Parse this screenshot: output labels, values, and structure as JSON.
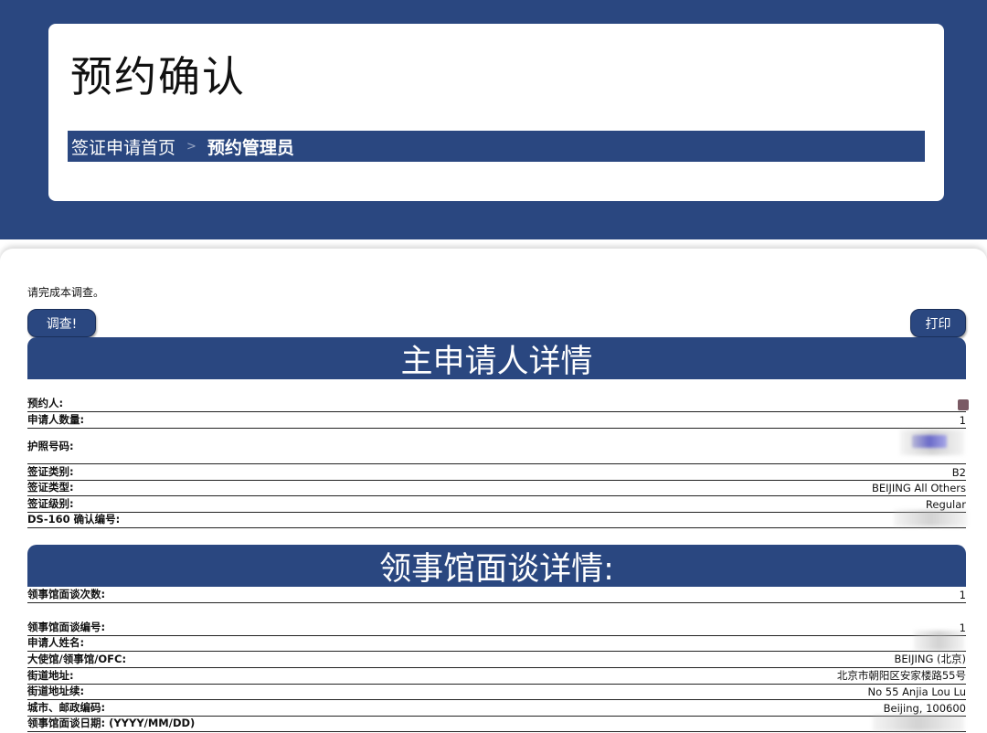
{
  "header": {
    "title": "预约确认",
    "breadcrumb": {
      "home": "签证申请首页",
      "separator": ">",
      "current": "预约管理员"
    }
  },
  "content": {
    "survey_note": "请完成本调查。",
    "survey_button": "调查!",
    "print_button": "打印"
  },
  "applicant_section": {
    "title": "主申请人详情",
    "rows": [
      {
        "label": "预约人:",
        "value": ""
      },
      {
        "label": "申请人数量:",
        "value": "1"
      },
      {
        "label": "护照号码:",
        "value": ""
      },
      {
        "label": "签证类别:",
        "value": "B2"
      },
      {
        "label": "签证类型:",
        "value": "BEIJING All Others"
      },
      {
        "label": "签证级别:",
        "value": "Regular"
      },
      {
        "label": "DS-160 确认编号:",
        "value": ""
      }
    ]
  },
  "interview_section": {
    "title": "领事馆面谈详情:",
    "rows": [
      {
        "label": "领事馆面谈次数:",
        "value": "1"
      },
      {
        "label": "领事馆面谈编号:",
        "value": "1"
      },
      {
        "label": "申请人姓名:",
        "value": ""
      },
      {
        "label": "大使馆/领事馆/OFC:",
        "value": "BEIJING (北京)"
      },
      {
        "label": "街道地址:",
        "value": "北京市朝阳区安家楼路55号"
      },
      {
        "label": "街道地址续:",
        "value": "No 55 Anjia Lou Lu"
      },
      {
        "label": "城市、邮政编码:",
        "value": "Beijing, 100600"
      },
      {
        "label": "领事馆面谈日期: (YYYY/MM/DD)",
        "value": ""
      }
    ]
  },
  "colors": {
    "primary": "#2a4780",
    "white": "#ffffff",
    "text": "#111111"
  }
}
